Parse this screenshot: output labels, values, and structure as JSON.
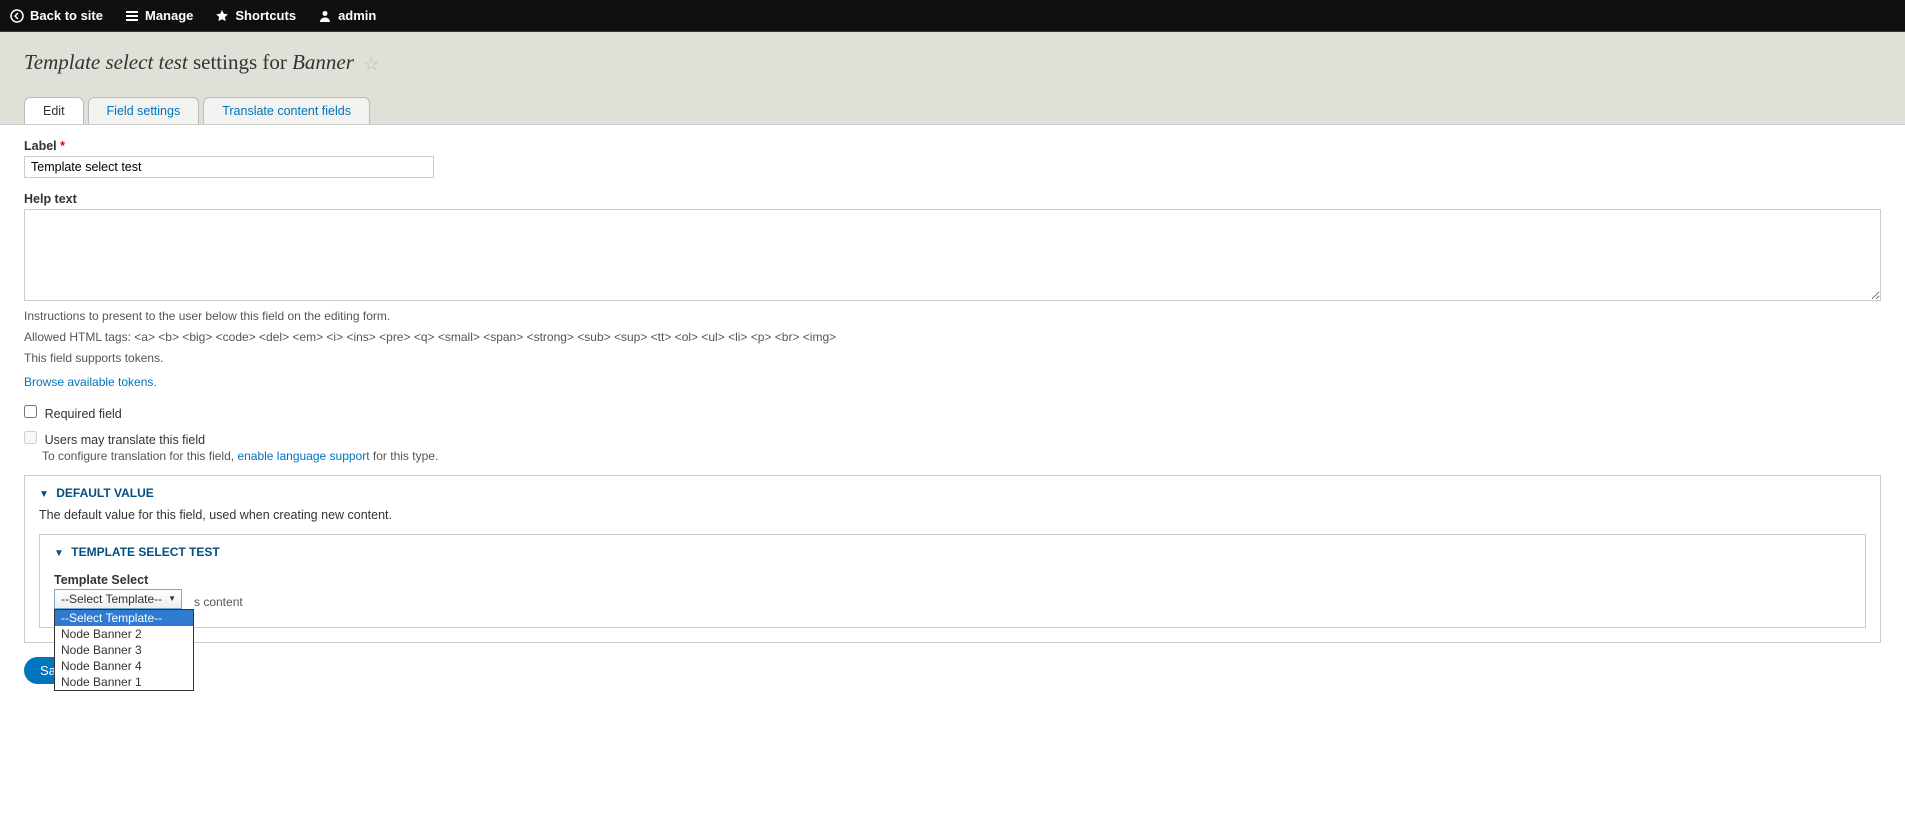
{
  "toolbar": {
    "back": "Back to site",
    "manage": "Manage",
    "shortcuts": "Shortcuts",
    "user": "admin"
  },
  "page_title": {
    "prefix": "Template select test",
    "middle": " settings for ",
    "suffix": "Banner"
  },
  "tabs": {
    "edit": "Edit",
    "field_settings": "Field settings",
    "translate": "Translate content fields"
  },
  "form": {
    "label_label": "Label",
    "label_value": "Template select test",
    "help_label": "Help text",
    "help_value": "",
    "help_desc1": "Instructions to present to the user below this field on the editing form.",
    "help_desc2": "Allowed HTML tags: <a> <b> <big> <code> <del> <em> <i> <ins> <pre> <q> <small> <span> <strong> <sub> <sup> <tt> <ol> <ul> <li> <p> <br> <img>",
    "help_desc3": "This field supports tokens.",
    "browse_tokens": "Browse available tokens",
    "required_label": "Required field",
    "users_translate_label": "Users may translate this field",
    "translate_desc_pre": "To configure translation for this field, ",
    "translate_desc_link": "enable language support",
    "translate_desc_post": " for this type."
  },
  "default_value": {
    "legend": "Default value",
    "desc": "The default value for this field, used when creating new content.",
    "inner_legend": "Template select test",
    "ts_label": "Template Select",
    "ts_value": "--Select Template--",
    "ts_options": [
      "--Select Template--",
      "Node Banner 2",
      "Node Banner 3",
      "Node Banner 4",
      "Node Banner 1"
    ],
    "ts_hint_partial": "s content"
  },
  "buttons": {
    "save_partial": "Sa"
  }
}
